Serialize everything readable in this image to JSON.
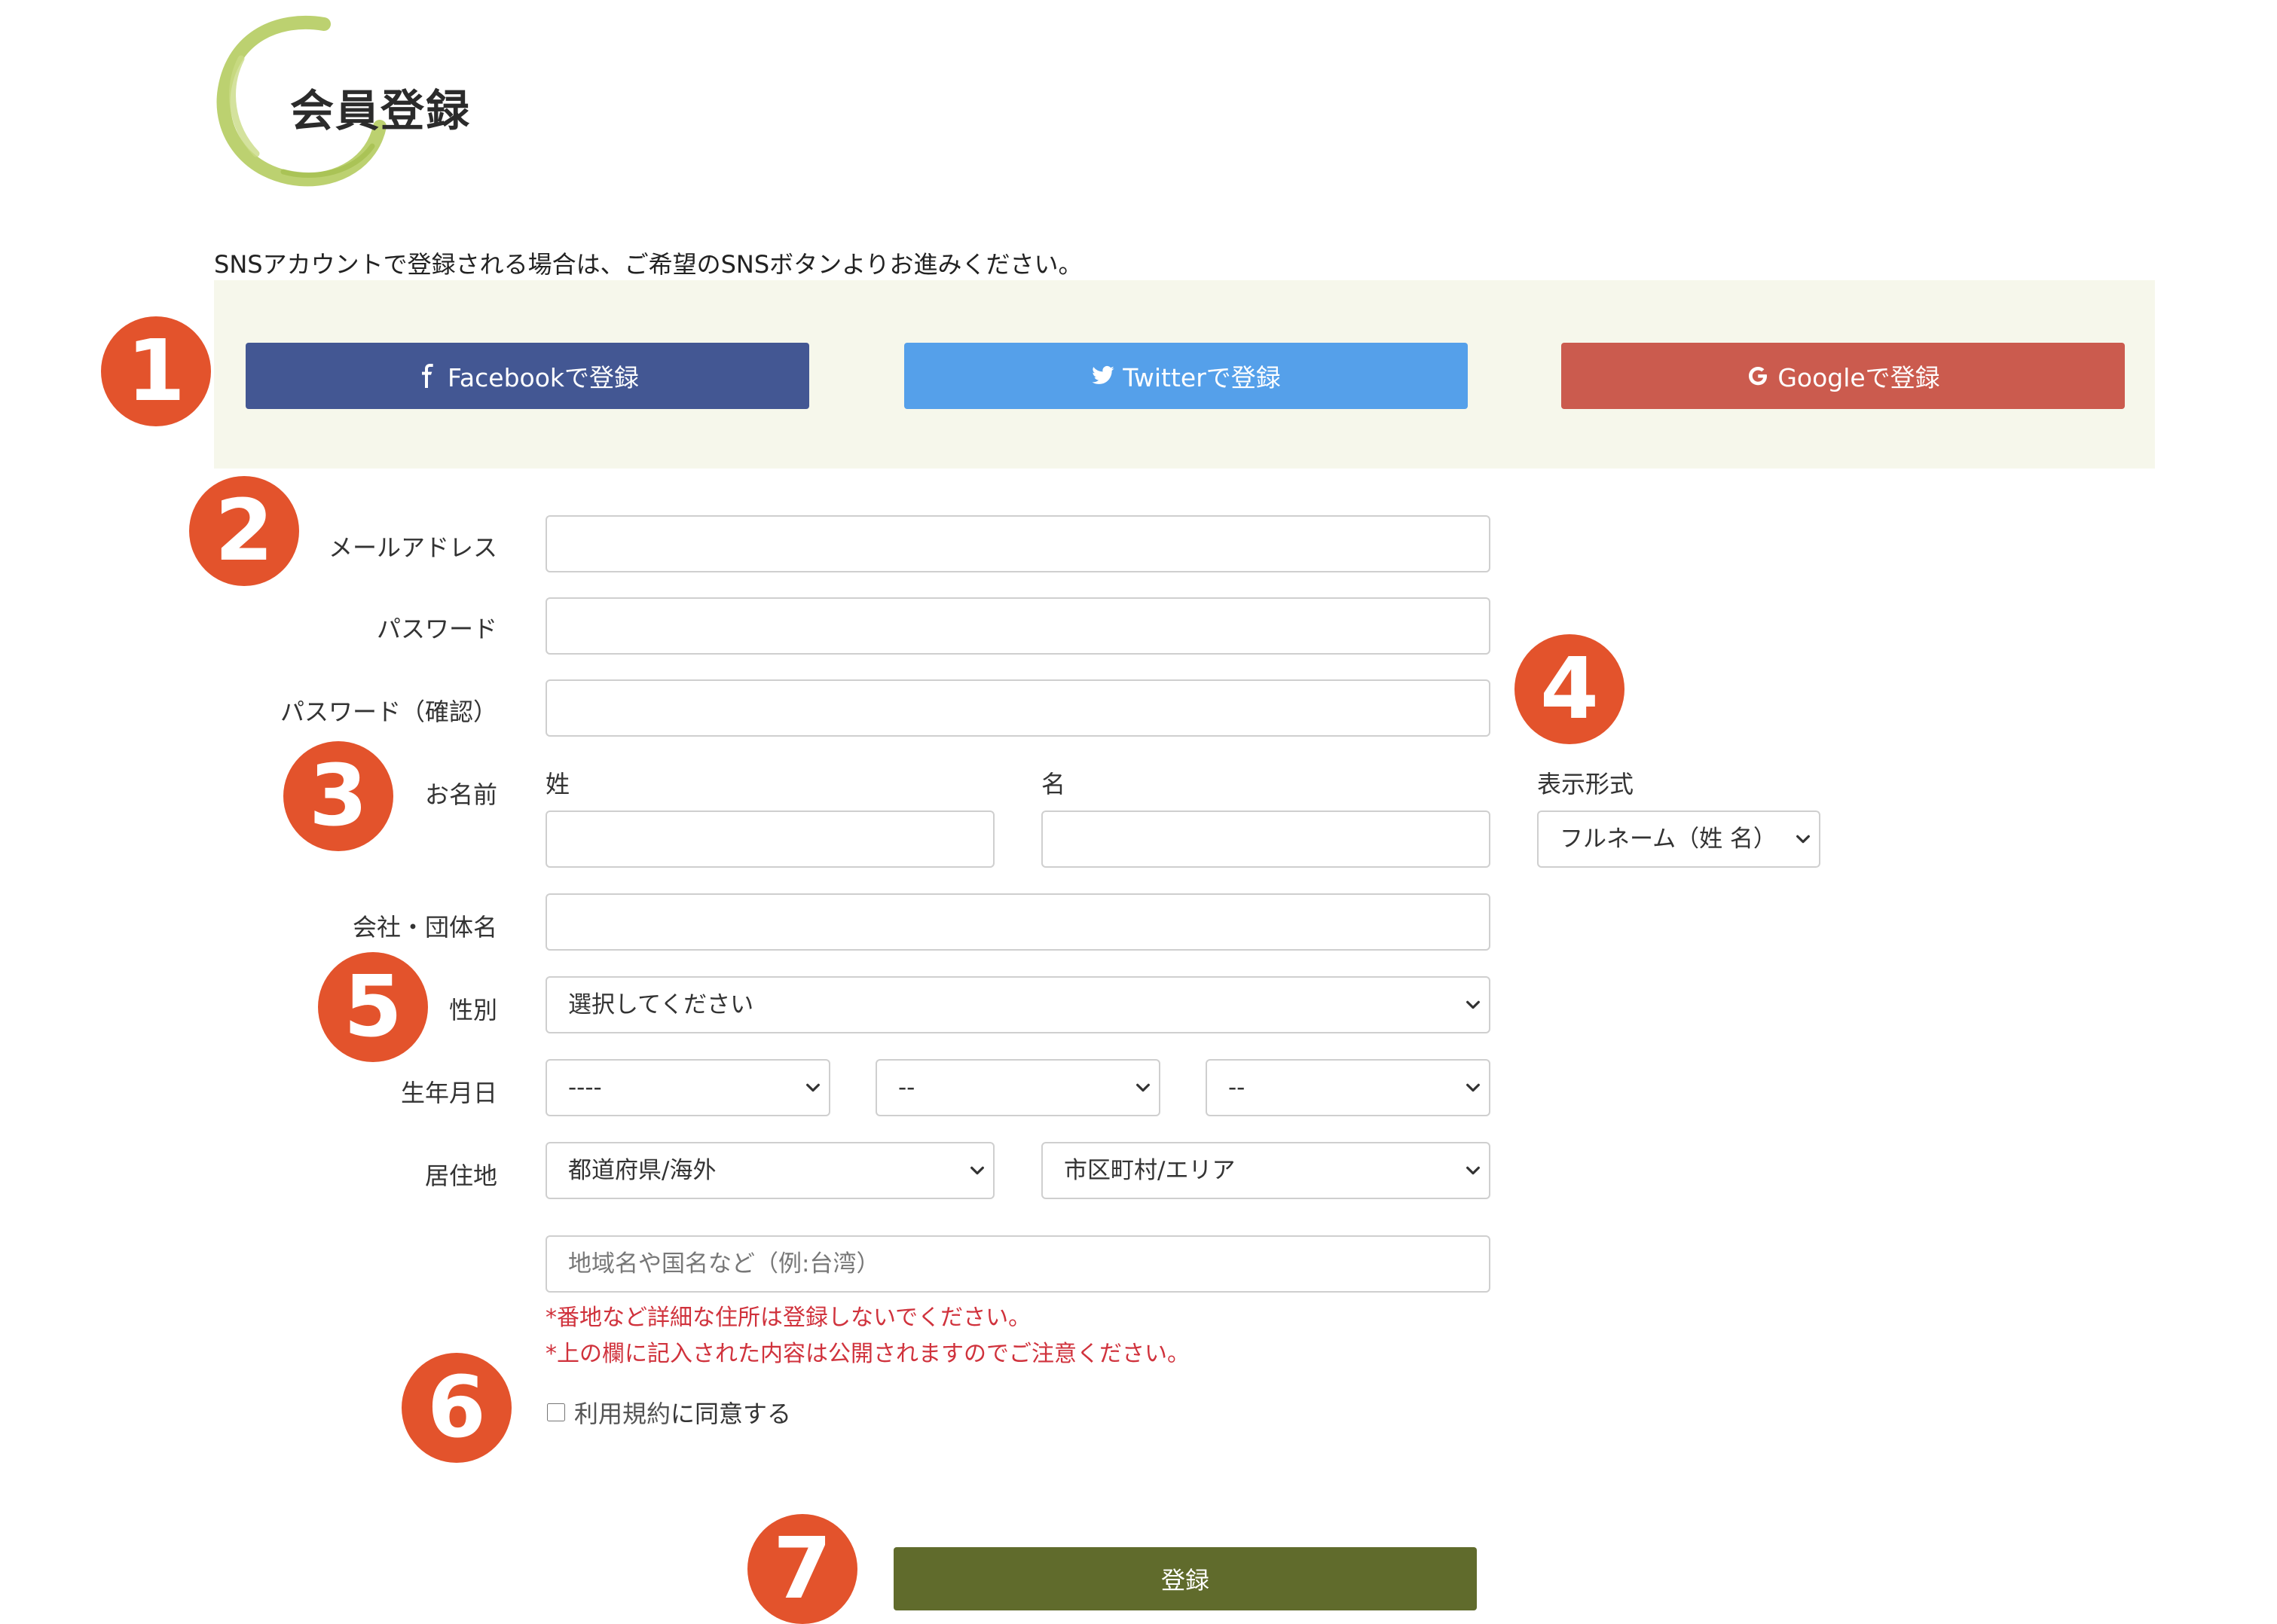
{
  "header": {
    "title": "会員登録"
  },
  "sns": {
    "note": "SNSアカウントで登録される場合は、ご希望のSNSボタンよりお進みください。",
    "facebook_label": "Facebookで登録",
    "twitter_label": "Twitterで登録",
    "google_label": "Googleで登録"
  },
  "badges": [
    "1",
    "2",
    "3",
    "4",
    "5",
    "6",
    "7"
  ],
  "form": {
    "email_label": "メールアドレス",
    "email_value": "",
    "password_label": "パスワード",
    "password_value": "",
    "password_confirm_label": "パスワード（確認）",
    "password_confirm_value": "",
    "name_label": "お名前",
    "last_name_label": "姓",
    "first_name_label": "名",
    "display_format_label": "表示形式",
    "display_format_value": "フルネーム（姓 名）",
    "company_label": "会社・団体名",
    "gender_label": "性別",
    "gender_value": "選択してください",
    "birthday_label": "生年月日",
    "birth_year_value": "----",
    "birth_month_value": "--",
    "birth_day_value": "--",
    "residence_label": "居住地",
    "prefecture_value": "都道府県/海外",
    "city_value": "市区町村/エリア",
    "area_placeholder": "地域名や国名など（例:台湾）",
    "note_1": "*番地など詳細な住所は登録しないでください。",
    "note_2": "*上の欄に記入された内容は公開されますのでご注意ください。",
    "terms_link": "利用規約",
    "terms_suffix": "に同意する",
    "submit_label": "登録"
  },
  "colors": {
    "facebook": "#435793",
    "twitter": "#55a0ea",
    "google": "#cb5b4e",
    "badge": "#e3532c",
    "submit": "#606b2c",
    "sns_panel": "#f6f7eb",
    "note_red": "#d0323c",
    "logo_ring": "#b5cc61"
  },
  "icons": [
    "facebook-icon",
    "twitter-icon",
    "google-icon",
    "chevron-down-icon"
  ]
}
